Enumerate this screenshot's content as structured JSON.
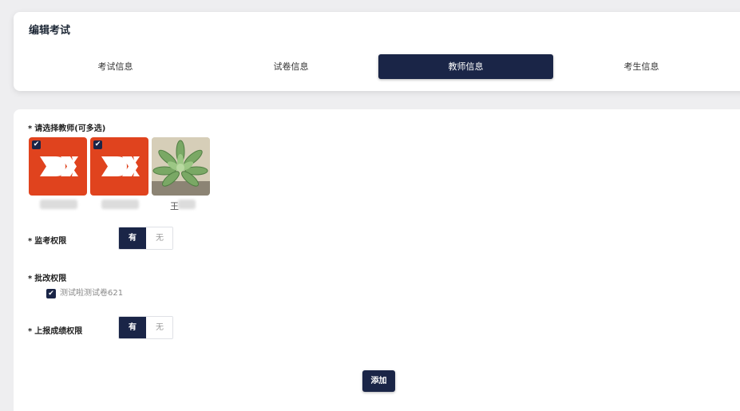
{
  "header": {
    "title": "编辑考试",
    "tabs": [
      {
        "label": "考试信息",
        "active": false
      },
      {
        "label": "试卷信息",
        "active": false
      },
      {
        "label": "教师信息",
        "active": true
      },
      {
        "label": "考生信息",
        "active": false
      }
    ]
  },
  "form": {
    "teachers_label": "请选择教师(可多选)",
    "teachers": [
      {
        "avatar": "dx-logo",
        "checked": true,
        "name_blurred": true
      },
      {
        "avatar": "dx-logo",
        "checked": true,
        "name_blurred": true
      },
      {
        "avatar": "succulent-photo",
        "checked": false,
        "name_blurred": true
      }
    ],
    "teacher_name_partial": "王",
    "proctor_label": "监考权限",
    "proctor_options": {
      "yes": "有",
      "no": "无",
      "selected": "有"
    },
    "grading_label": "批改权限",
    "grading_paper": "测试啦测试卷621",
    "grading_checked": true,
    "report_label": "上报成绩权限",
    "report_options": {
      "yes": "有",
      "no": "无",
      "selected": "有"
    },
    "add_button": "添加"
  },
  "colors": {
    "primary": "#1a2547",
    "logo_bg": "#e0431e"
  }
}
